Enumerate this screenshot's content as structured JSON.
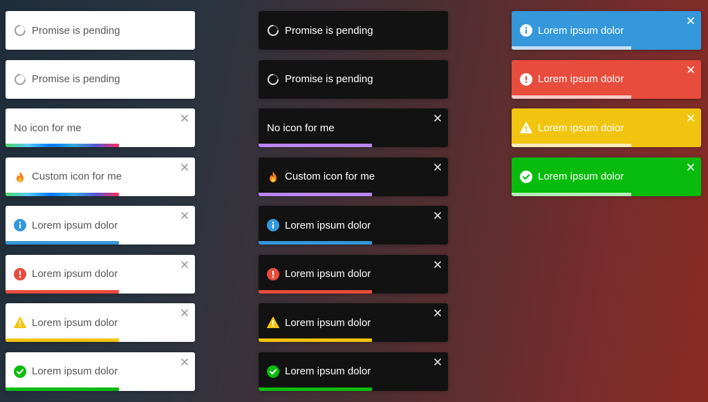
{
  "columns": {
    "light": {
      "toasts": [
        {
          "text": "Promise is pending",
          "icon": "spinner-icon",
          "close": false,
          "progress": null,
          "progress_color": null
        },
        {
          "text": "Promise is pending",
          "icon": "spinner-icon",
          "close": false,
          "progress": null,
          "progress_color": null
        },
        {
          "text": "No icon for me",
          "icon": null,
          "close": true,
          "progress": 0.6,
          "progress_color": "rainbow"
        },
        {
          "text": "Custom icon for me",
          "icon": "fire-icon",
          "close": true,
          "progress": 0.6,
          "progress_color": "rainbow"
        },
        {
          "text": "Lorem ipsum dolor",
          "icon": "info-icon",
          "close": true,
          "progress": 0.6,
          "progress_color": "#3498db"
        },
        {
          "text": "Lorem ipsum dolor",
          "icon": "error-icon",
          "close": true,
          "progress": 0.6,
          "progress_color": "#e74c3c"
        },
        {
          "text": "Lorem ipsum dolor",
          "icon": "warning-icon",
          "close": true,
          "progress": 0.6,
          "progress_color": "#f1c40f"
        },
        {
          "text": "Lorem ipsum dolor",
          "icon": "success-icon",
          "close": true,
          "progress": 0.6,
          "progress_color": "#07bc0c"
        }
      ]
    },
    "dark": {
      "toasts": [
        {
          "text": "Promise is pending",
          "icon": "spinner-icon",
          "close": false,
          "progress": null,
          "progress_color": null
        },
        {
          "text": "Promise is pending",
          "icon": "spinner-icon",
          "close": false,
          "progress": null,
          "progress_color": null
        },
        {
          "text": "No icon for me",
          "icon": null,
          "close": true,
          "progress": 0.6,
          "progress_color": "#bb86fc"
        },
        {
          "text": "Custom icon for me",
          "icon": "fire-icon",
          "close": true,
          "progress": 0.6,
          "progress_color": "#bb86fc"
        },
        {
          "text": "Lorem ipsum dolor",
          "icon": "info-icon",
          "close": true,
          "progress": 0.6,
          "progress_color": "#3498db"
        },
        {
          "text": "Lorem ipsum dolor",
          "icon": "error-icon",
          "close": true,
          "progress": 0.6,
          "progress_color": "#e74c3c"
        },
        {
          "text": "Lorem ipsum dolor",
          "icon": "warning-icon",
          "close": true,
          "progress": 0.6,
          "progress_color": "#f1c40f"
        },
        {
          "text": "Lorem ipsum dolor",
          "icon": "success-icon",
          "close": true,
          "progress": 0.6,
          "progress_color": "#07bc0c"
        }
      ]
    },
    "colored": {
      "toasts": [
        {
          "text": "Lorem ipsum dolor",
          "icon": "info-icon",
          "close": true,
          "progress": 0.63,
          "background": "#3498db",
          "progress_color": "rgba(255,255,255,0.7)"
        },
        {
          "text": "Lorem ipsum dolor",
          "icon": "error-icon",
          "close": true,
          "progress": 0.63,
          "background": "#e74c3c",
          "progress_color": "rgba(255,255,255,0.7)"
        },
        {
          "text": "Lorem ipsum dolor",
          "icon": "warning-icon",
          "close": true,
          "progress": 0.63,
          "background": "#f1c40f",
          "progress_color": "rgba(255,255,255,0.7)"
        },
        {
          "text": "Lorem ipsum dolor",
          "icon": "success-icon",
          "close": true,
          "progress": 0.63,
          "background": "#07bc0c",
          "progress_color": "rgba(255,255,255,0.7)"
        }
      ]
    }
  },
  "colors": {
    "info": "#3498db",
    "error": "#e74c3c",
    "warning": "#f1c40f",
    "success": "#07bc0c",
    "dark_progress": "#bb86fc"
  }
}
